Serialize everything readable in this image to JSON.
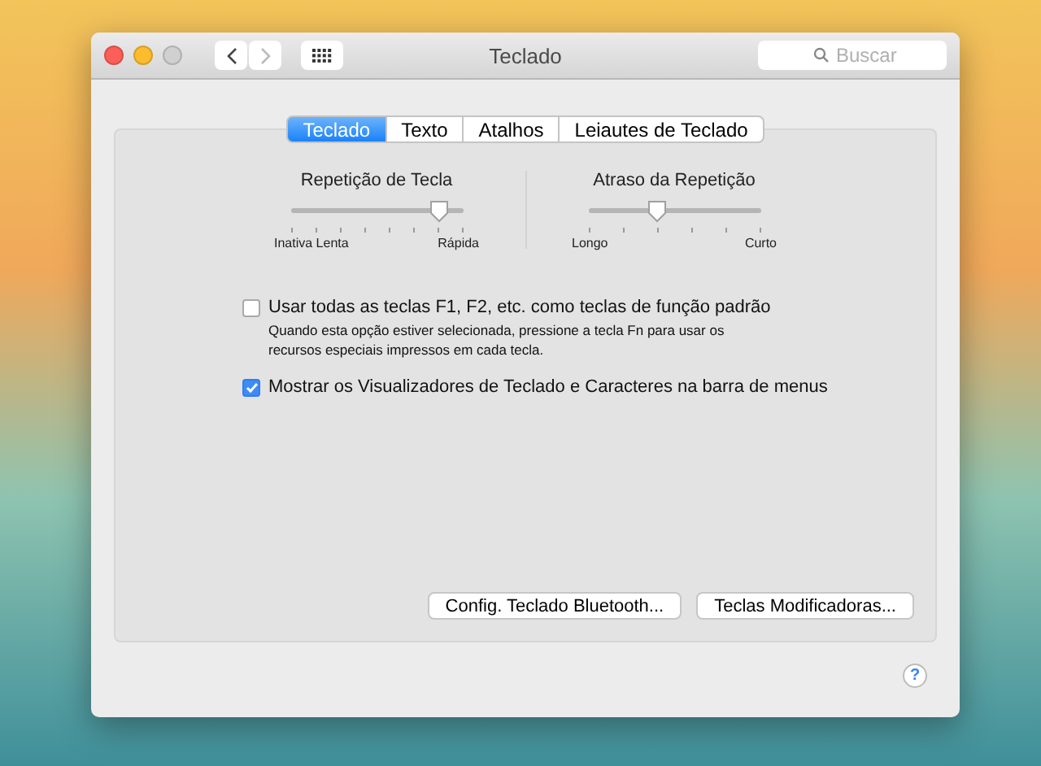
{
  "window": {
    "title": "Teclado"
  },
  "search": {
    "placeholder": "Buscar"
  },
  "tabs": [
    {
      "label": "Teclado",
      "selected": true
    },
    {
      "label": "Texto",
      "selected": false
    },
    {
      "label": "Atalhos",
      "selected": false
    },
    {
      "label": "Leiautes de Teclado",
      "selected": false
    }
  ],
  "sliders": [
    {
      "title": "Repetição de Tecla",
      "level": 0.86,
      "min_label": "Inativa Lenta",
      "max_label": "Rápida"
    },
    {
      "title": "Atraso da Repetição",
      "level": 0.4,
      "min_label": "Longo",
      "max_label": "Curto"
    }
  ],
  "options": [
    {
      "label": "Usar todas as teclas F1, F2, etc. como teclas de função padrão",
      "checked": false,
      "description": "Quando esta opção estiver selecionada, pressione a tecla Fn para usar os recursos especiais impressos em cada tecla."
    },
    {
      "label": "Mostrar os Visualizadores de Teclado e Caracteres na barra de menus",
      "checked": true
    }
  ],
  "buttons": [
    "Config. Teclado Bluetooth...",
    "Teclas Modificadoras..."
  ],
  "help": "?"
}
